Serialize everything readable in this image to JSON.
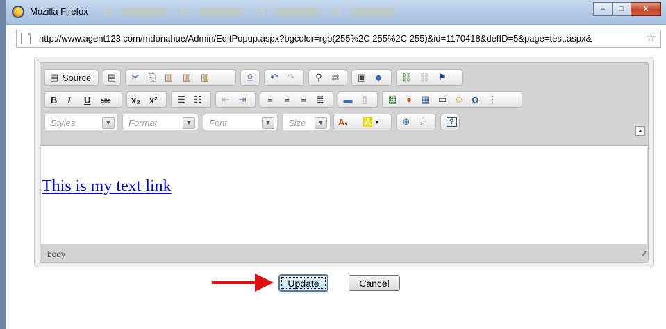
{
  "window": {
    "title": "Mozilla Firefox",
    "minimize_glyph": "–",
    "maximize_glyph": "□",
    "close_glyph": "X"
  },
  "address_bar": {
    "url": "http://www.agent123.com/mdonahue/Admin/EditPopup.aspx?bgcolor=rgb(255%2C 255%2C 255)&id=1170418&defID=5&page=test.aspx&"
  },
  "toolbar": {
    "source_label": "Source",
    "bold_label": "B",
    "italic_label": "I",
    "underline_label": "U",
    "strike_label": "abc",
    "subscript_label": "x₂",
    "superscript_label": "x²",
    "styles_placeholder": "Styles",
    "format_placeholder": "Format",
    "font_placeholder": "Font",
    "size_placeholder": "Size",
    "help_label": "?",
    "omega_label": "Ω"
  },
  "editor": {
    "content_link_text": "This is my text link",
    "element_path": "body"
  },
  "buttons": {
    "update_label": "Update",
    "cancel_label": "Cancel"
  },
  "colors": {
    "link": "#0000cc",
    "annotation_arrow": "#e01010"
  }
}
